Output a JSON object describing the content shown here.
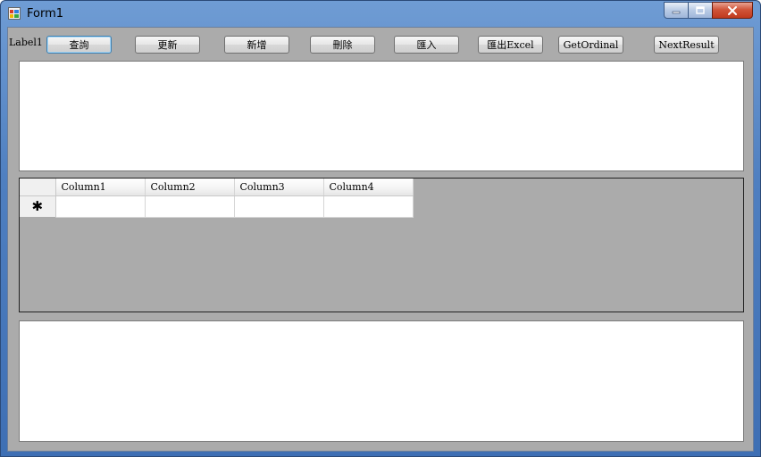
{
  "window": {
    "title": "Form1",
    "controls": {
      "minimize": "minimize",
      "maximize": "maximize",
      "close": "close"
    }
  },
  "toolbar": {
    "label": "Label1",
    "buttons": [
      {
        "label": "查詢"
      },
      {
        "label": "更新"
      },
      {
        "label": "新增"
      },
      {
        "label": "刪除"
      },
      {
        "label": "匯入"
      },
      {
        "label": "匯出Excel"
      },
      {
        "label": "GetOrdinal"
      },
      {
        "label": "NextResult"
      }
    ]
  },
  "grid": {
    "columns": [
      "Column1",
      "Column2",
      "Column3",
      "Column4"
    ],
    "new_row_marker": "✱",
    "rows": [
      [
        "",
        "",
        "",
        ""
      ]
    ]
  },
  "colors": {
    "form_background": "#ababab",
    "focus_border": "#3c7fb1"
  }
}
